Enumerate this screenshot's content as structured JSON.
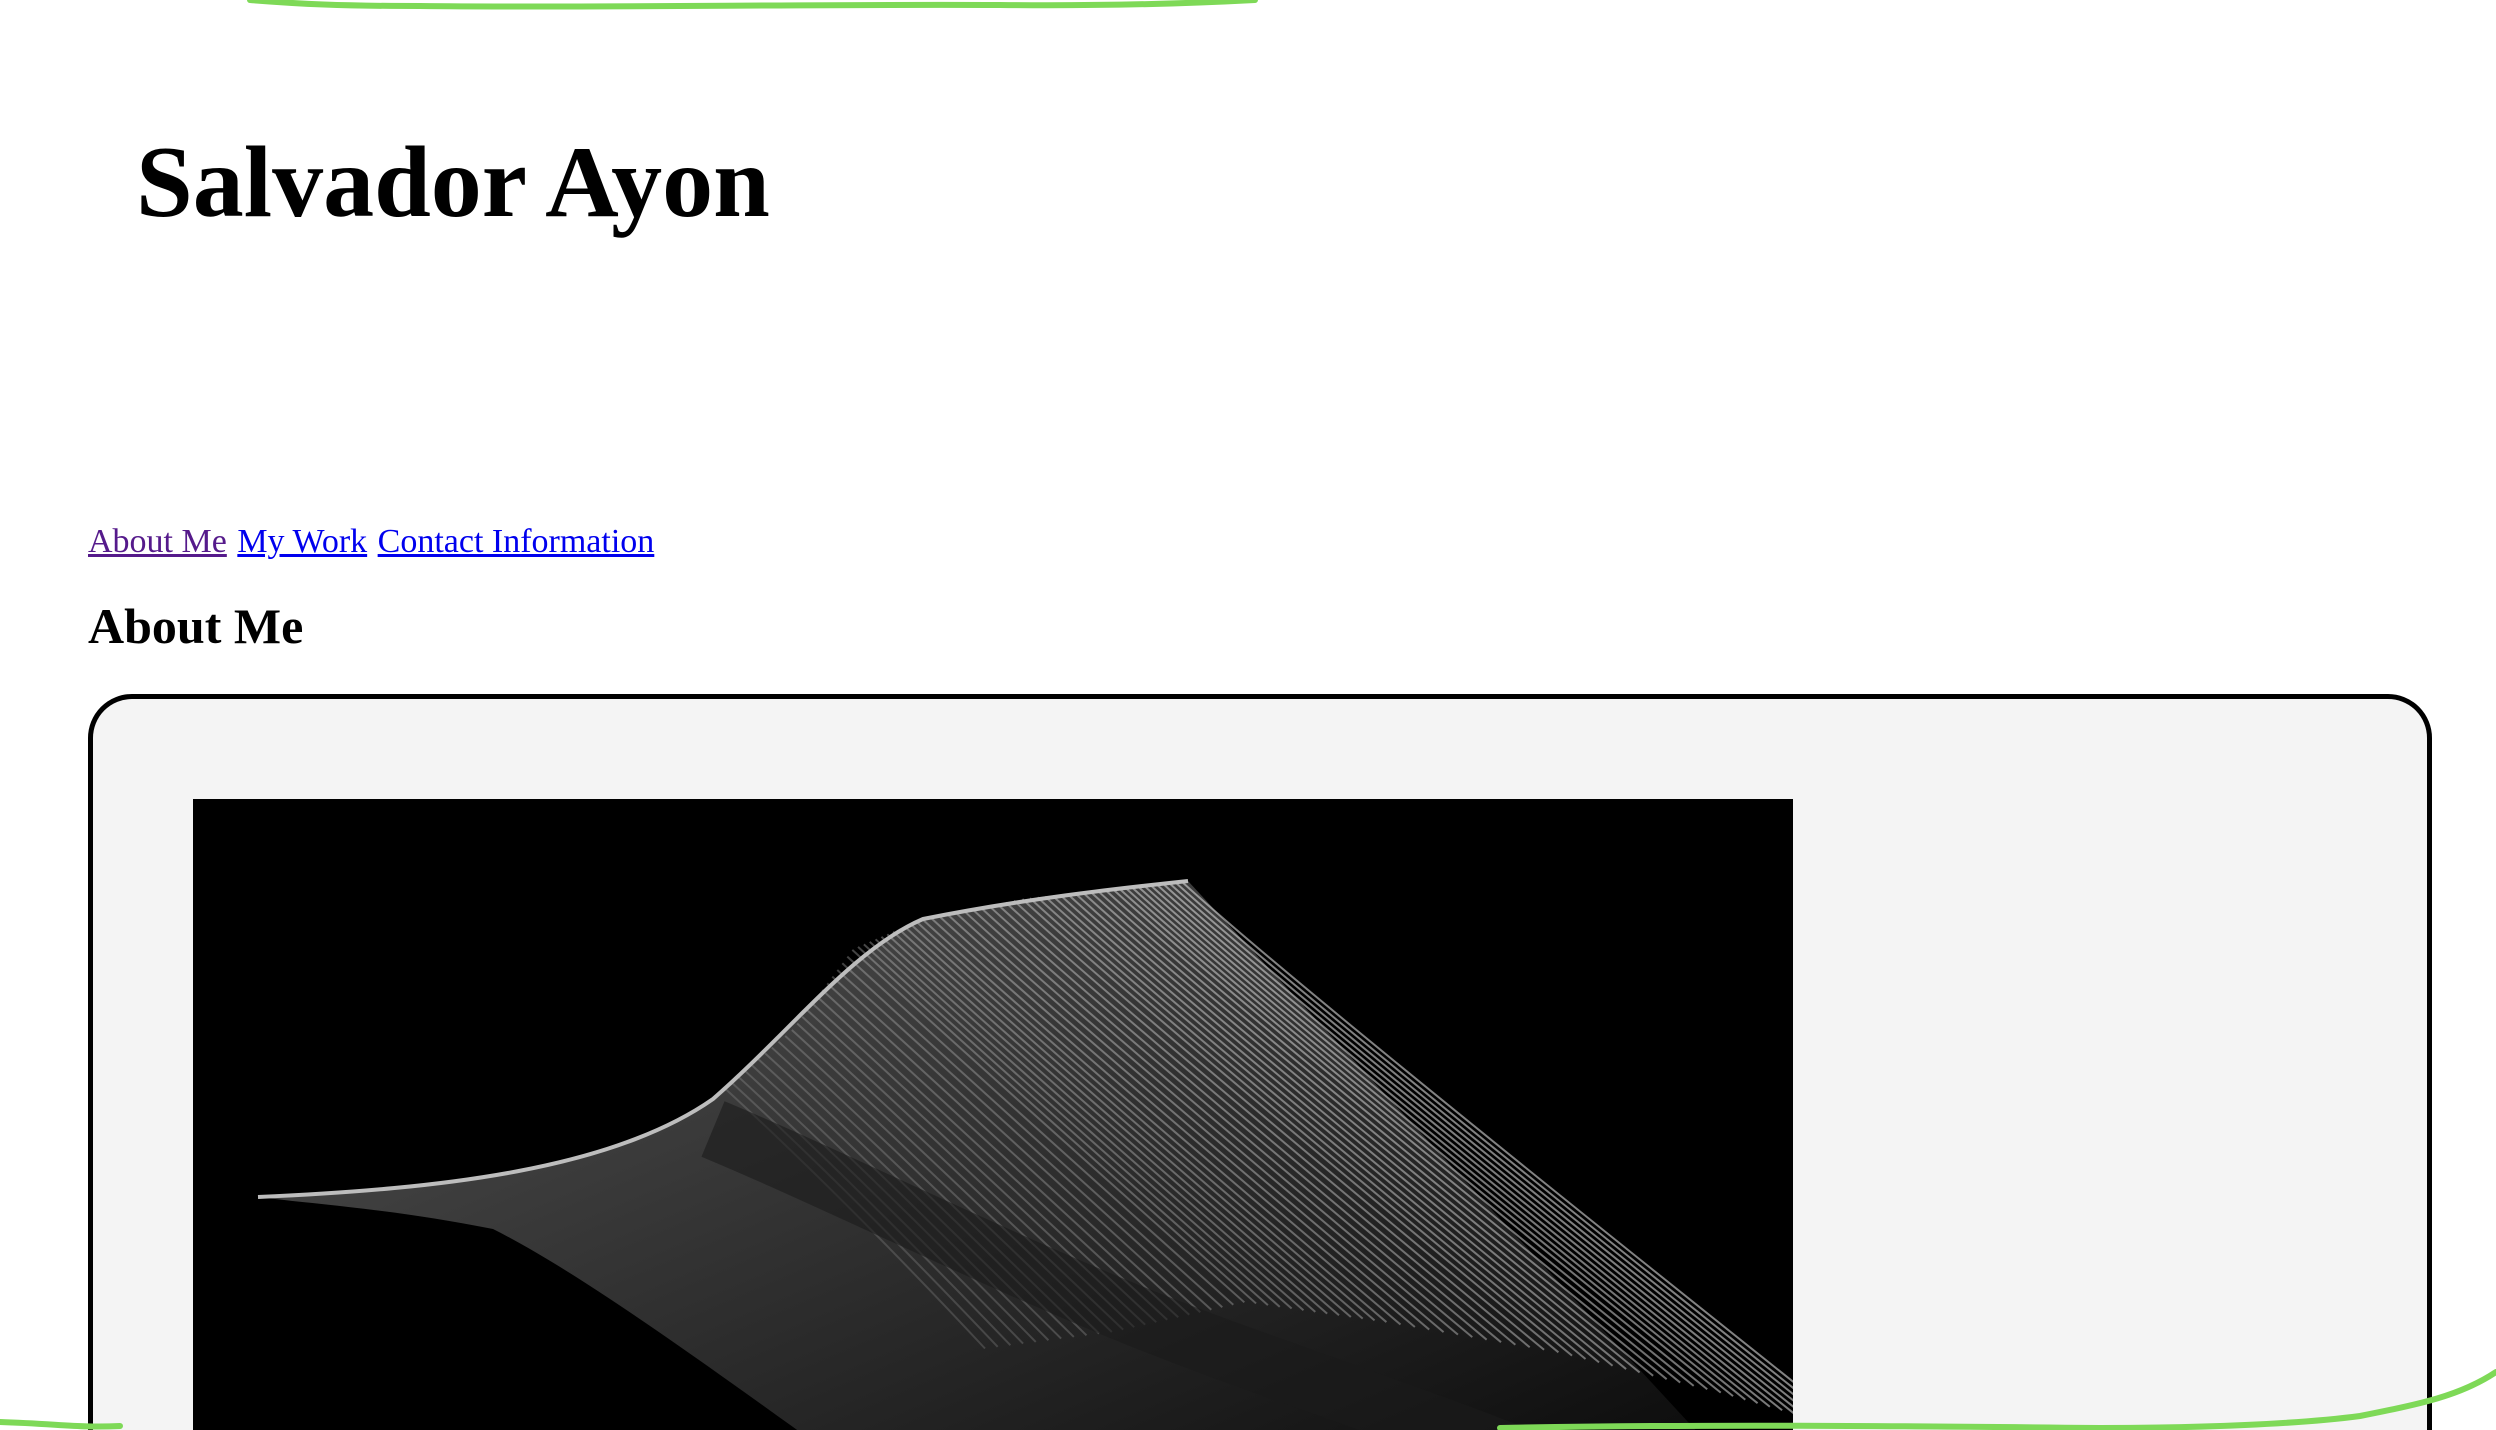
{
  "header": {
    "title": "Salvador Ayon"
  },
  "nav": {
    "items": [
      {
        "label": "About Me",
        "visited": true
      },
      {
        "label": "My Work",
        "visited": false
      },
      {
        "label": "Contact Information",
        "visited": false
      }
    ]
  },
  "about": {
    "heading": "About Me"
  },
  "colors": {
    "accent_scribble": "#7ed957",
    "link": "#0000ee",
    "link_visited": "#551a8b",
    "card_background": "#f4f4f4",
    "card_border": "#000000"
  }
}
